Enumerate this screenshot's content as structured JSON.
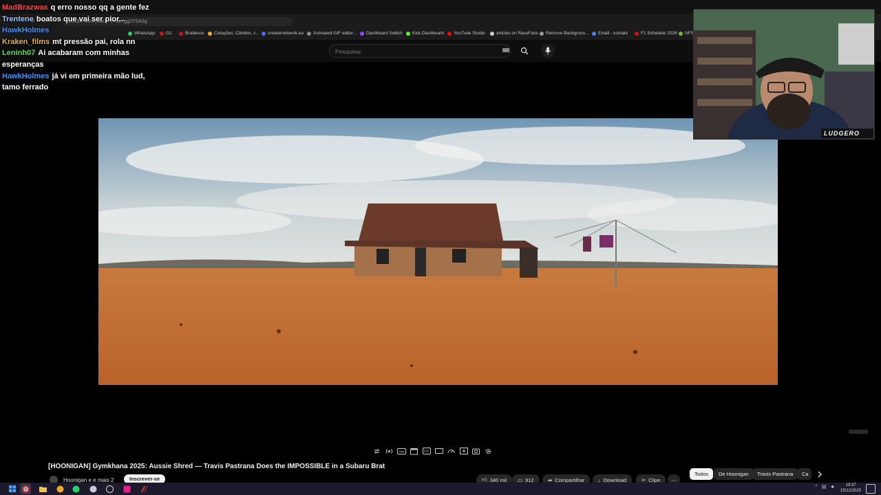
{
  "browser": {
    "url": "youtube.com/watch?v=daYgg2YSA3g",
    "bookmarks": [
      {
        "label": "WhatsApp",
        "color": "#25d366"
      },
      {
        "label": "G1",
        "color": "#c4170c"
      },
      {
        "label": "Bradesco",
        "color": "#cc092f"
      },
      {
        "label": "Cotações: Câmbio, c...",
        "color": "#f5a623"
      },
      {
        "label": "creatornetwork.ea",
        "color": "#4a6cf7"
      },
      {
        "label": "Animated GIF editor...",
        "color": "#888888"
      },
      {
        "label": "Dashboard Switch",
        "color": "#9146ff"
      },
      {
        "label": "Kick Dashboard",
        "color": "#53fc18"
      },
      {
        "label": "YouTube Studio",
        "color": "#ff0000"
      },
      {
        "label": "articles on RaceFans",
        "color": "#cccccc"
      },
      {
        "label": "Remove Backgroun...",
        "color": "#999999"
      },
      {
        "label": "Email - contato",
        "color": "#4285f4"
      },
      {
        "label": "F1 Schedule 2026",
        "color": "#e10600"
      },
      {
        "label": "NFS",
        "color": "#7cb342"
      }
    ]
  },
  "youtube": {
    "search_placeholder": "Pesquisar"
  },
  "chat": {
    "messages": [
      {
        "user": "MadBrazwas",
        "color": "#ff4a4a",
        "text": "q erro nosso qq a gente fez"
      },
      {
        "user": "Trentene",
        "color": "#9ec5ff",
        "text": "boatos que vai ser pior..."
      },
      {
        "user": "HawkHolmes",
        "color": "#4a90ff",
        "text": ""
      },
      {
        "user": "Kraken_films",
        "color": "#e0b060",
        "text": "mt pressão pai, rola nn"
      },
      {
        "user": "Leninh07",
        "color": "#55dd66",
        "text": "Ai acabaram com minhas esperanças"
      },
      {
        "user": "HawkHolmes",
        "color": "#4a90ff",
        "text": "já vi em primeira mão lud, tamo ferrado"
      }
    ]
  },
  "webcam": {
    "tag": "LUDGERO"
  },
  "video": {
    "title": "[HOONIGAN] Gymkhana 2025: Aussie Shred — Travis Pastrana Does the IMPOSSIBLE in a Subaru Brat",
    "channel": "Hoonigan e e mais 2",
    "subscribe_label": "Inscrever-se",
    "likes": "340 mil",
    "comments": "912",
    "share_label": "Compartilhar",
    "download_label": "Download",
    "clip_label": "Clipe"
  },
  "chips": [
    "Todos",
    "De Hoonigan",
    "Travis Pastrana",
    "Ca"
  ],
  "clock": {
    "time": "19:37",
    "date": "15/12/2025"
  }
}
